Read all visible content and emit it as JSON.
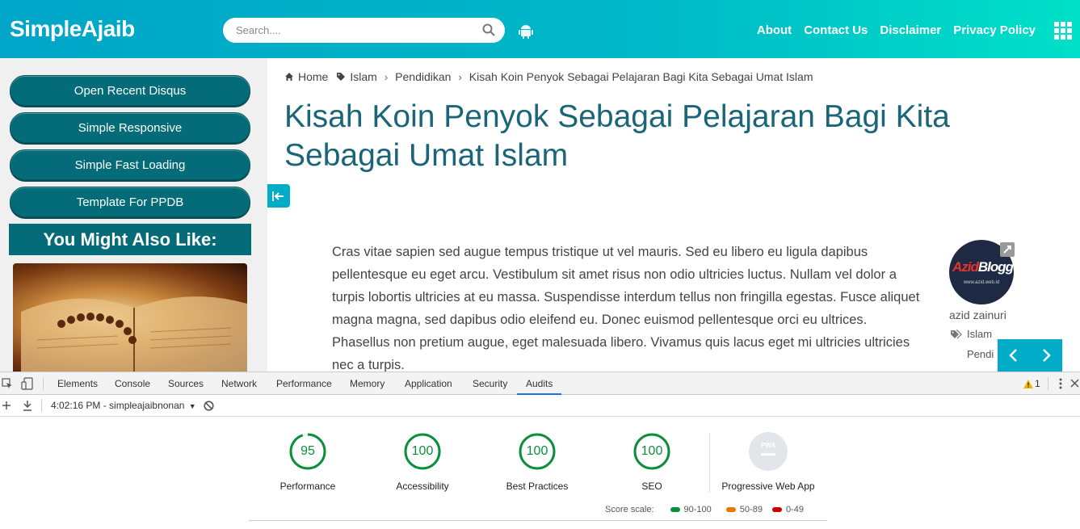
{
  "header": {
    "logo": "SimpleAjaib",
    "search_placeholder": "Search....",
    "nav": [
      "About",
      "Contact Us",
      "Disclaimer",
      "Privacy Policy"
    ],
    "bg_start": "#00a5c8",
    "bg_end": "#00e0c8"
  },
  "sidebar": {
    "buttons": [
      "Open Recent Disqus",
      "Simple Responsive",
      "Simple Fast Loading",
      "Template For PPDB"
    ],
    "also_title": "You Might Also Like:",
    "accent": "#046c78"
  },
  "breadcrumb": [
    "Home",
    "Islam",
    "Pendidikan",
    "Kisah Koin Penyok Sebagai Pelajaran Bagi Kita Sebagai Umat Islam"
  ],
  "post": {
    "title": "Kisah Koin Penyok Sebagai Pelajaran Bagi Kita Sebagai Umat Islam",
    "body": "Cras vitae sapien sed augue tempus tristique ut vel mauris. Sed eu libero eu ligula dapibus pellentesque eu eget arcu. Vestibulum sit amet risus non odio ultricies luctus. Nullam vel dolor a turpis lobortis ultricies at eu massa. Suspendisse interdum tellus non fringilla egestas. Fusce aliquet magna magna, sed dapibus odio eleifend eu. Donec euismod pellentesque orci eu ultrices. Phasellus non pretium augue, eget malesuada libero. Vivamus quis lacus eget mi ultricies ultricies nec a turpis."
  },
  "author": {
    "avatar_brand_a": "Azid",
    "avatar_brand_b": "Blogger",
    "avatar_url": "www.azid.web.id",
    "name": "azid zainuri",
    "tag1": "Islam",
    "tag2": "Pendi"
  },
  "devtools": {
    "tabs": [
      "Elements",
      "Console",
      "Sources",
      "Network",
      "Performance",
      "Memory",
      "Application",
      "Security",
      "Audits"
    ],
    "active_tab": "Audits",
    "warning_count": "1",
    "session": "4:02:16 PM - simpleajaibnonan",
    "scores": [
      {
        "label": "Performance",
        "value": "95"
      },
      {
        "label": "Accessibility",
        "value": "100"
      },
      {
        "label": "Best Practices",
        "value": "100"
      },
      {
        "label": "SEO",
        "value": "100"
      }
    ],
    "pwa_label": "Progressive Web App",
    "pwa_badge": "PWA",
    "scale_label": "Score scale:",
    "scale": [
      {
        "range": "90-100",
        "color": "#0c8f3c"
      },
      {
        "range": "50-89",
        "color": "#e67700"
      },
      {
        "range": "0-49",
        "color": "#cc0000"
      }
    ]
  }
}
